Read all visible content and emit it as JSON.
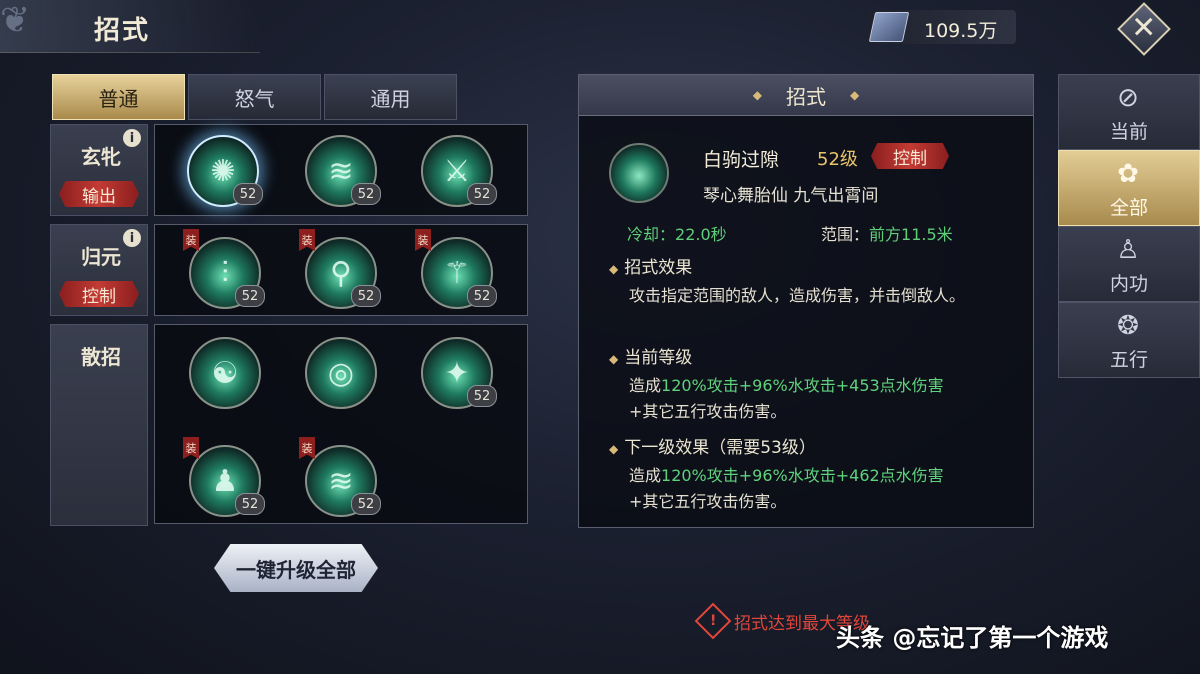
{
  "header": {
    "title": "招式",
    "currency_value": "109.5万"
  },
  "tabs": [
    {
      "label": "普通",
      "active": true
    },
    {
      "label": "怒气",
      "active": false
    },
    {
      "label": "通用",
      "active": false
    }
  ],
  "rows": [
    {
      "title": "玄牝",
      "role": "输出",
      "skills": [
        {
          "level": "52",
          "tag": ""
        },
        {
          "level": "52",
          "tag": ""
        },
        {
          "level": "52",
          "tag": ""
        }
      ]
    },
    {
      "title": "归元",
      "role": "控制",
      "skills": [
        {
          "level": "52",
          "tag": "装"
        },
        {
          "level": "52",
          "tag": "装"
        },
        {
          "level": "52",
          "tag": "装"
        }
      ]
    },
    {
      "title": "散招",
      "role": "",
      "skills": [
        {
          "level": "",
          "tag": ""
        },
        {
          "level": "",
          "tag": ""
        },
        {
          "level": "52",
          "tag": ""
        },
        {
          "level": "52",
          "tag": "装"
        },
        {
          "level": "52",
          "tag": "装"
        }
      ]
    }
  ],
  "upgrade_all_label": "一键升级全部",
  "detail": {
    "header": "招式",
    "name": "白驹过隙",
    "level": "52级",
    "role": "控制",
    "subtitle": "琴心舞胎仙 九气出霄间",
    "cooldown_label": "冷却：",
    "cooldown_value": "22.0秒",
    "range_label": "范围：",
    "range_value": "前方11.5米",
    "effect_title": "招式效果",
    "effect_text": "攻击指定范围的敌人，造成伤害，并击倒敌人。",
    "current_title": "当前等级",
    "current_pre": "造成",
    "current_green": "120%攻击+96%水攻击+453点水伤害",
    "current_post": "+其它五行攻击伤害。",
    "next_title": "下一级效果（需要53级）",
    "next_pre": "造成",
    "next_green": "120%攻击+96%水攻击+462点水伤害",
    "next_post": "+其它五行攻击伤害。"
  },
  "side_tabs": [
    {
      "label": "当前",
      "icon": "swirl-icon",
      "active": false
    },
    {
      "label": "全部",
      "icon": "yin-yang-icon",
      "active": true
    },
    {
      "label": "内功",
      "icon": "meditation-icon",
      "active": false
    },
    {
      "label": "五行",
      "icon": "five-elements-icon",
      "active": false
    }
  ],
  "warning": "招式达到最大等级",
  "watermark": "头条 @忘记了第一个游戏",
  "colors": {
    "accent_gold": "#d9b978",
    "role_red": "#c33b34",
    "green_text": "#5fd27c",
    "warning_red": "#e0463a"
  }
}
